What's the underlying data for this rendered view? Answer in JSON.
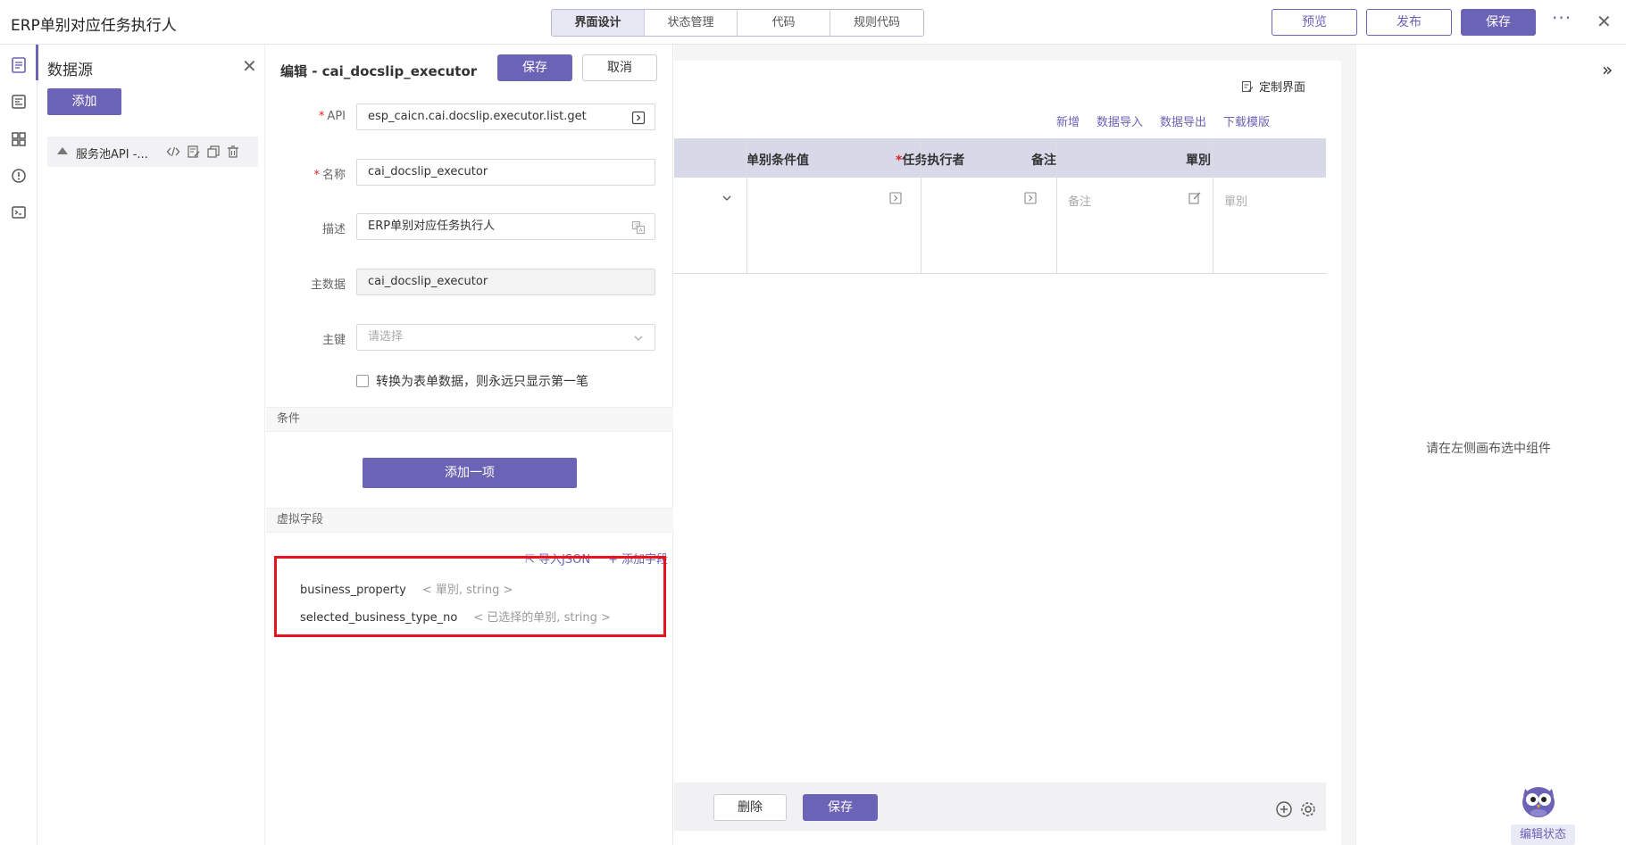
{
  "header": {
    "title": "ERP单别对应任务执行人",
    "tabs": [
      {
        "label": "界面设计",
        "active": true
      },
      {
        "label": "状态管理",
        "active": false
      },
      {
        "label": "代码",
        "active": false
      },
      {
        "label": "规则代码",
        "active": false
      }
    ],
    "preview_label": "预览",
    "publish_label": "发布",
    "save_label": "保存"
  },
  "datasource": {
    "title": "数据源",
    "add_label": "添加",
    "item_label": "服务池API -..."
  },
  "edit": {
    "title": "编辑 - cai_docslip_executor",
    "save_label": "保存",
    "cancel_label": "取消",
    "fields": {
      "api_label": "API",
      "api_value": "esp_caicn.cai.docslip.executor.list.get",
      "name_label": "名称",
      "name_value": "cai_docslip_executor",
      "desc_label": "描述",
      "desc_value": "ERP单别对应任务执行人",
      "master_label": "主数据",
      "master_value": "cai_docslip_executor",
      "key_label": "主键",
      "key_placeholder": "请选择"
    },
    "checkbox_label": "转换为表单数据，则永远只显示第一笔",
    "conditions_title": "条件",
    "add_item_label": "添加一项",
    "virtual_fields_title": "虚拟字段",
    "import_json_label": "导入JSON",
    "add_field_label": "+ 添加字段",
    "virtual_fields": [
      {
        "name": "business_property",
        "meta": "< 單別, string >"
      },
      {
        "name": "selected_business_type_no",
        "meta": "< 已选择的单别, string >"
      }
    ]
  },
  "canvas": {
    "custom_ui_label": "定制界面",
    "toolbar": [
      "新增",
      "数据导入",
      "数据导出",
      "下载模版"
    ],
    "columns": [
      {
        "label": "单别条件值",
        "required": false
      },
      {
        "label": "任务执行者",
        "required": true
      },
      {
        "label": "备注",
        "required": false
      },
      {
        "label": "單別",
        "required": false
      }
    ],
    "row_placeholders": {
      "remark": "备注",
      "docslip": "單別"
    },
    "delete_label": "删除",
    "save_label": "保存"
  },
  "right": {
    "hint": "请在左侧画布选中组件",
    "edit_state_label": "编辑状态"
  },
  "colors": {
    "accent": "#6b63b5",
    "highlight": "#e8141b",
    "grid_header": "#d7d9e9"
  }
}
